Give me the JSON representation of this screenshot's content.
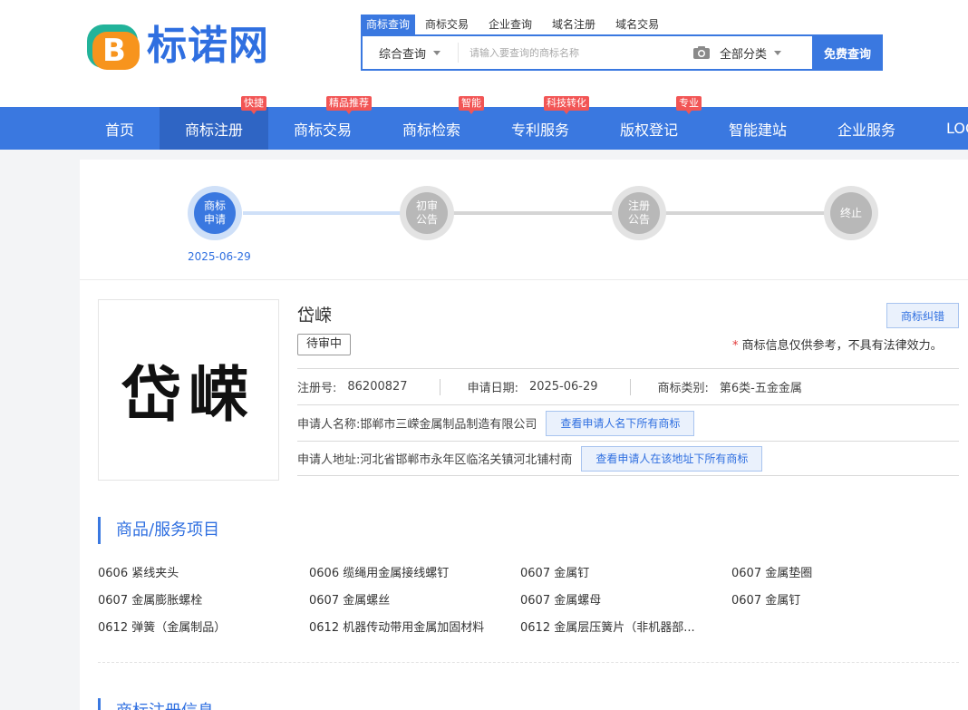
{
  "header": {
    "logo_text": "标诺网",
    "logo_letter": "B",
    "search_tabs": [
      "商标查询",
      "商标交易",
      "企业查询",
      "域名注册",
      "域名交易"
    ],
    "search_type": "综合查询",
    "search_placeholder": "请输入要查询的商标名称",
    "search_category": "全部分类",
    "search_button": "免费查询"
  },
  "nav": {
    "items": [
      {
        "label": "首页"
      },
      {
        "label": "商标注册",
        "badge": "快捷"
      },
      {
        "label": "商标交易",
        "badge": "精品推荐"
      },
      {
        "label": "商标检索",
        "badge": "智能"
      },
      {
        "label": "专利服务",
        "badge": "科技转化"
      },
      {
        "label": "版权登记",
        "badge": "专业"
      },
      {
        "label": "智能建站"
      },
      {
        "label": "企业服务"
      },
      {
        "label": "LOGO"
      }
    ],
    "active_index": 1
  },
  "progress": {
    "steps": [
      {
        "line1": "商标",
        "line2": "申请",
        "state": "done",
        "date": "2025-06-29"
      },
      {
        "line1": "初审",
        "line2": "公告",
        "state": "pending"
      },
      {
        "line1": "注册",
        "line2": "公告",
        "state": "pending"
      },
      {
        "line1": "终止",
        "line2": "",
        "state": "pending"
      }
    ]
  },
  "trademark": {
    "image_text": "岱嵘",
    "name": "岱嵘",
    "status": "待审中",
    "correct_button": "商标纠错",
    "disclaimer_star": "*",
    "disclaimer": "商标信息仅供参考，不具有法律效力。",
    "reg_no_label": "注册号:",
    "reg_no": "86200827",
    "apply_date_label": "申请日期:",
    "apply_date": "2025-06-29",
    "category_label": "商标类别:",
    "category": "第6类-五金金属",
    "applicant_label": "申请人名称:",
    "applicant": "邯郸市三嵘金属制品制造有限公司",
    "applicant_button": "查看申请人名下所有商标",
    "address_label": "申请人地址:",
    "address": "河北省邯郸市永年区临洺关镇河北铺村南",
    "address_button": "查看申请人在该地址下所有商标"
  },
  "goods": {
    "title": "商品/服务项目",
    "items": [
      "0606 紧线夹头",
      "0606 缆绳用金属接线螺钉",
      "0607 金属钉",
      "0607 金属垫圈",
      "0607 金属膨胀螺栓",
      "0607 金属螺丝",
      "0607 金属螺母",
      "0607 金属钉",
      "0612 弹簧（金属制品）",
      "0612 机器传动带用金属加固材料",
      "0612 金属层压簧片（非机器部..."
    ]
  },
  "next_section": {
    "title": "商标注册信息"
  },
  "colors": {
    "primary": "#3a78e0",
    "badge_red": "#f25555",
    "step_done": "#3a78e0",
    "step_pending": "#b8b8b8"
  }
}
